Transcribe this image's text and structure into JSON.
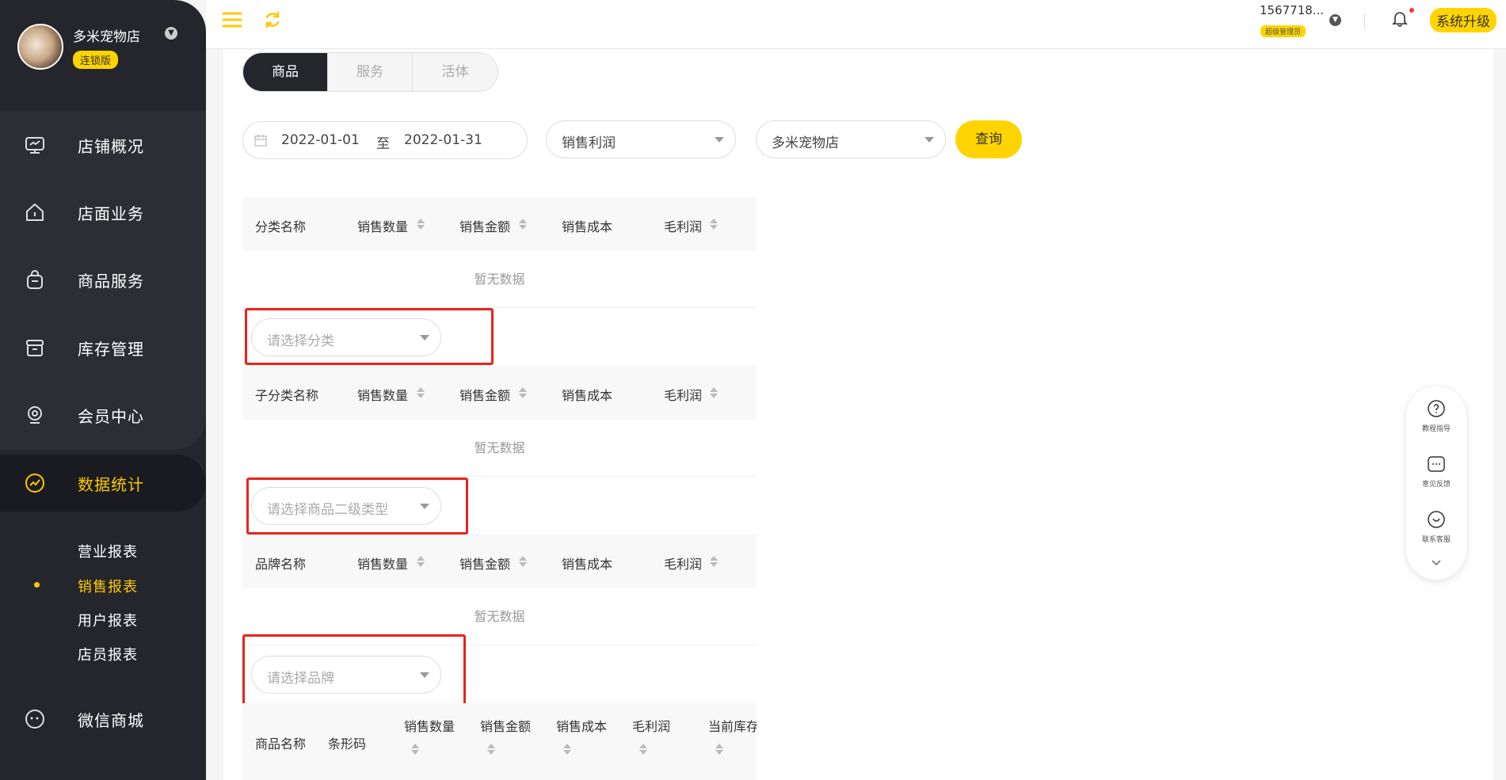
{
  "sidebar": {
    "store_name": "多米宠物店",
    "store_badge": "连锁版",
    "items": [
      {
        "label": "店铺概况",
        "icon": "monitor-icon"
      },
      {
        "label": "店面业务",
        "icon": "house-icon"
      },
      {
        "label": "商品服务",
        "icon": "bag-icon"
      },
      {
        "label": "库存管理",
        "icon": "box-icon"
      },
      {
        "label": "会员中心",
        "icon": "member-icon"
      },
      {
        "label": "数据统计",
        "icon": "chart-icon"
      },
      {
        "label": "微信商城",
        "icon": "chat-icon"
      }
    ],
    "sub_items": [
      {
        "label": "营业报表"
      },
      {
        "label": "销售报表"
      },
      {
        "label": "用户报表"
      },
      {
        "label": "店员报表"
      }
    ],
    "active_item": "数据统计",
    "active_sub_item": "销售报表"
  },
  "topbar": {
    "user_id": "1567718...",
    "role": "超级管理员",
    "upgrade_label": "系统升级"
  },
  "tabs": [
    {
      "label": "商品"
    },
    {
      "label": "服务"
    },
    {
      "label": "活体"
    }
  ],
  "filters": {
    "date_start": "2022-01-01",
    "date_sep": "至",
    "date_end": "2022-01-31",
    "metric": "销售利润",
    "store": "多米宠物店",
    "query_label": "查询"
  },
  "tables": {
    "category": {
      "headers": [
        "分类名称",
        "销售数量",
        "销售金额",
        "销售成本",
        "毛利润"
      ],
      "empty": "暂无数据"
    },
    "subcategory": {
      "filter_placeholder": "请选择分类",
      "headers": [
        "子分类名称",
        "销售数量",
        "销售金额",
        "销售成本",
        "毛利润"
      ],
      "empty": "暂无数据"
    },
    "brand": {
      "filter_placeholder": "请选择商品二级类型",
      "headers": [
        "品牌名称",
        "销售数量",
        "销售金额",
        "销售成本",
        "毛利润"
      ],
      "empty": "暂无数据"
    },
    "product": {
      "filter_placeholder": "请选择品牌",
      "headers": [
        "商品名称",
        "条形码",
        "销售数量",
        "销售金额",
        "销售成本",
        "毛利润",
        "当前库存"
      ]
    }
  },
  "help_panel": {
    "items": [
      {
        "label": "教程指导",
        "icon": "question-icon"
      },
      {
        "label": "意见反馈",
        "icon": "feedback-icon"
      },
      {
        "label": "联系客服",
        "icon": "service-icon"
      }
    ]
  },
  "colors": {
    "accent": "#ffc800",
    "sidebar_bg": "#24262c",
    "highlight_box": "#e8231b"
  }
}
